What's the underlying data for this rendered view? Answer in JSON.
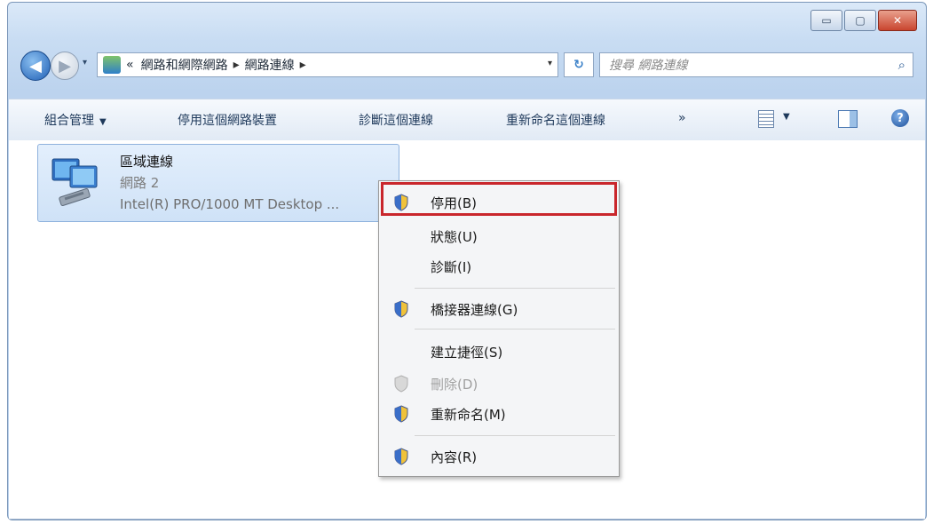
{
  "window": {
    "controls": {
      "minimize": "▭",
      "maximize": "▢",
      "close": "✕"
    }
  },
  "nav": {
    "back_icon": "◀",
    "forward_icon": "▶",
    "dropdown_icon": "▾",
    "address_prefix": "«",
    "breadcrumbs": [
      "網路和網際網路",
      "網路連線"
    ],
    "separator": "▸",
    "address_dropdown": "▾",
    "refresh_icon": "↻",
    "search_placeholder": "搜尋 網路連線",
    "search_icon": "⌕"
  },
  "toolbar": {
    "organize": "組合管理",
    "disable_device": "停用這個網路裝置",
    "diagnose": "診斷這個連線",
    "rename": "重新命名這個連線",
    "more": "»",
    "dropdown_arrow": "▼",
    "help": "?"
  },
  "connection": {
    "name": "區域連線",
    "network": "網路 2",
    "device": "Intel(R) PRO/1000 MT Desktop ..."
  },
  "context_menu": {
    "items": [
      {
        "label": "停用(B)",
        "shield": true,
        "disabled": false
      },
      {
        "label": "狀態(U)",
        "shield": false,
        "disabled": false
      },
      {
        "label": "診斷(I)",
        "shield": false,
        "disabled": false
      },
      {
        "label": "橋接器連線(G)",
        "shield": true,
        "disabled": false
      },
      {
        "label": "建立捷徑(S)",
        "shield": false,
        "disabled": false
      },
      {
        "label": "刪除(D)",
        "shield": true,
        "disabled": true
      },
      {
        "label": "重新命名(M)",
        "shield": true,
        "disabled": false
      },
      {
        "label": "內容(R)",
        "shield": true,
        "disabled": false
      }
    ],
    "highlight_color": "#c9262c"
  }
}
